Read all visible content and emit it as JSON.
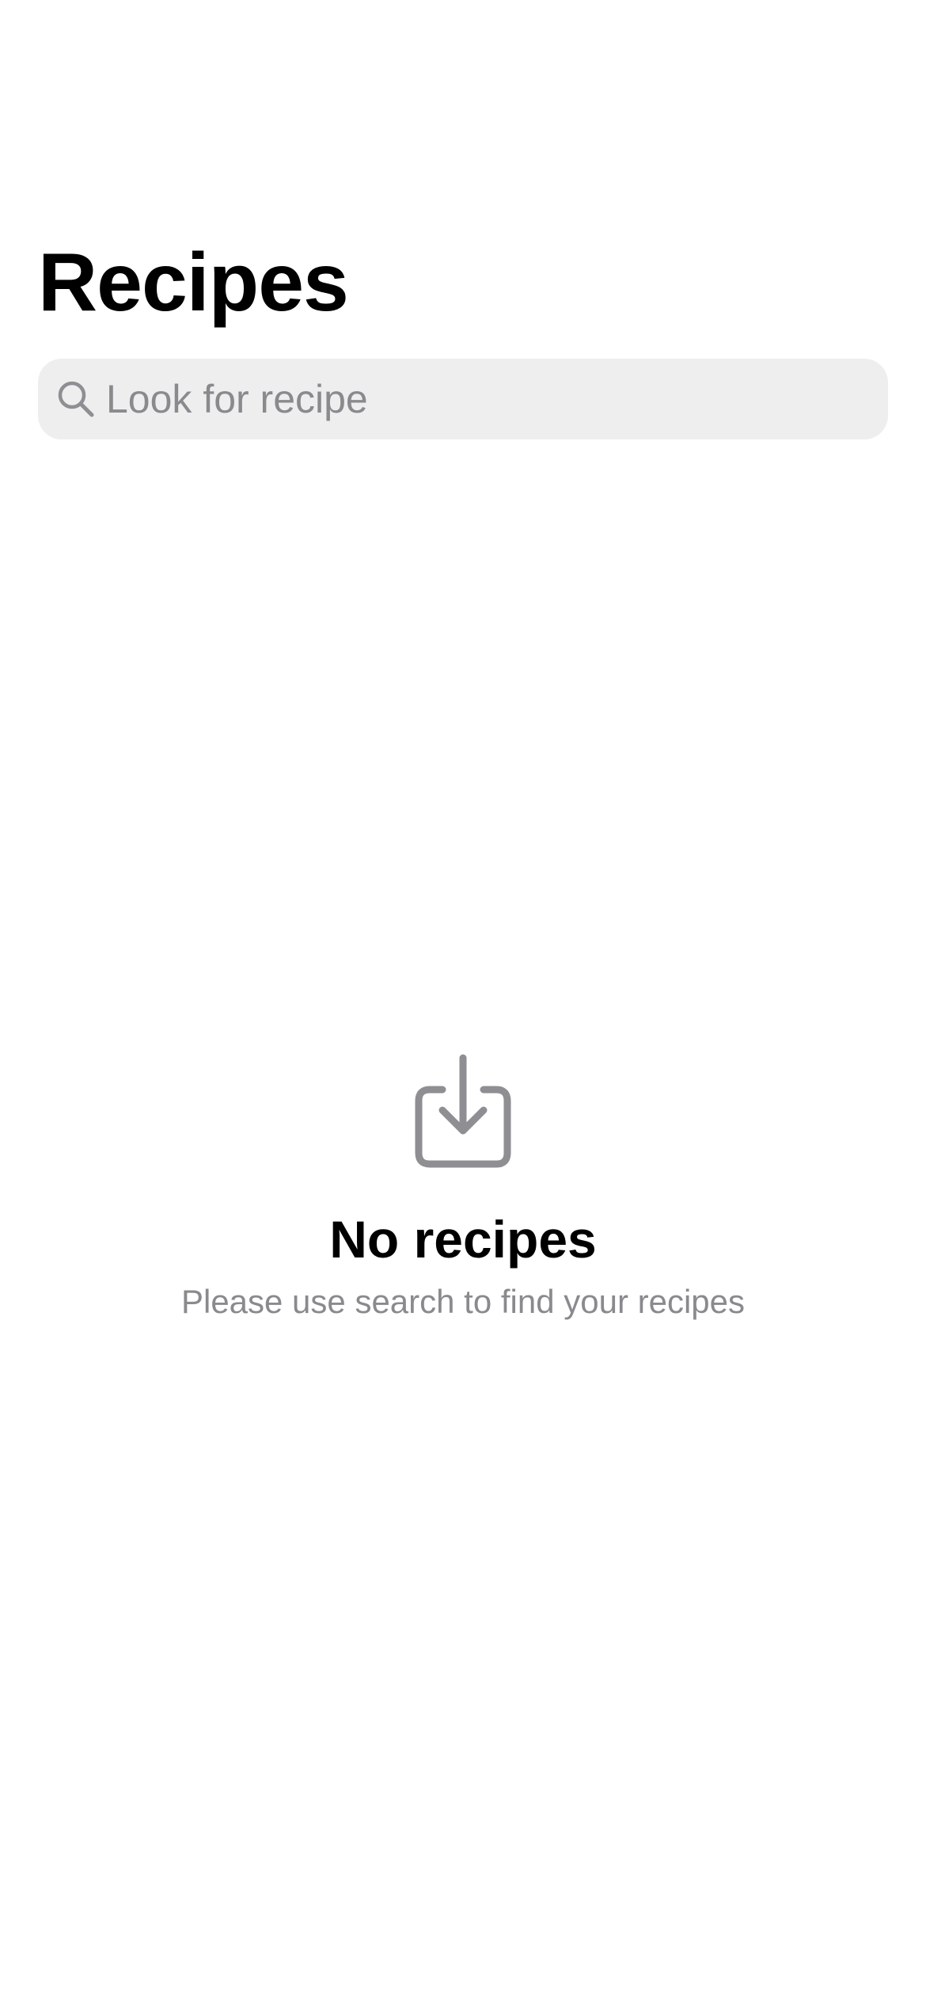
{
  "header": {
    "title": "Recipes"
  },
  "search": {
    "placeholder": "Look for recipe",
    "value": "",
    "icon": "search-icon"
  },
  "empty_state": {
    "icon": "tray-arrow-down-icon",
    "title": "No recipes",
    "subtitle": "Please use search to find your recipes"
  },
  "colors": {
    "background": "#ffffff",
    "search_field": "#eeeeee",
    "secondary_text": "#8a8a8e",
    "icon_gray": "#8e8e93"
  }
}
